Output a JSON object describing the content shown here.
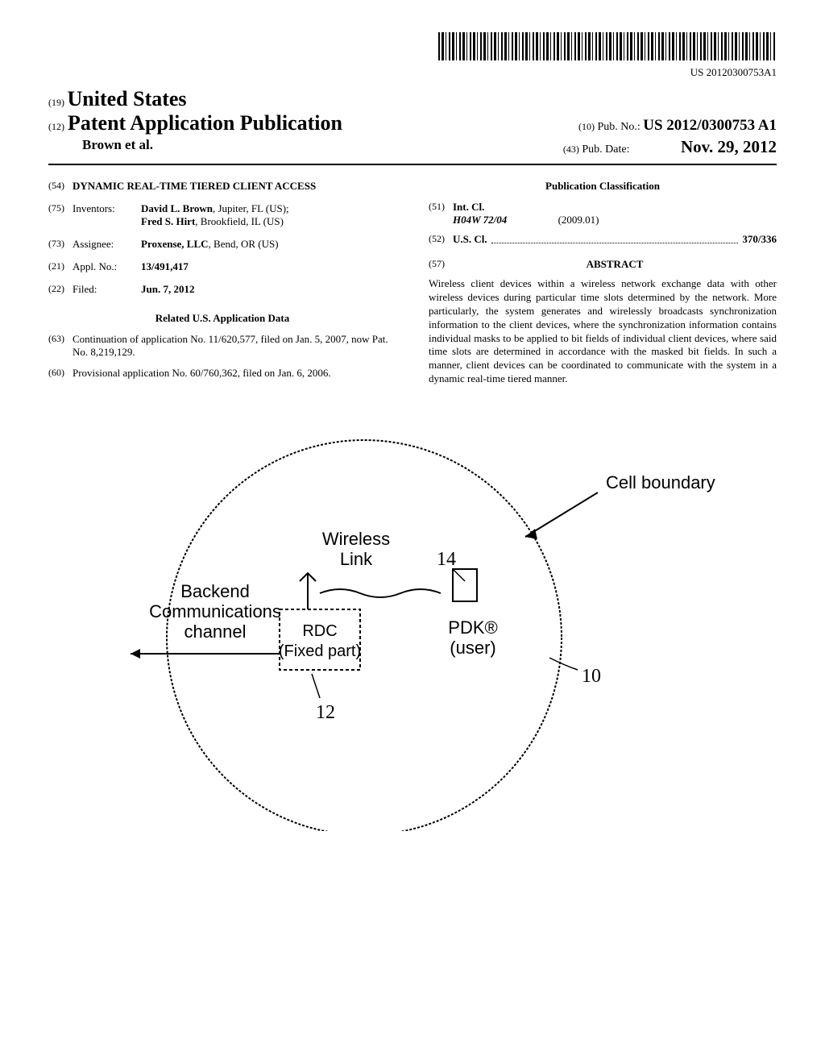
{
  "barcode_number": "US 20120300753A1",
  "header": {
    "country_num": "(19)",
    "country": "United States",
    "pub_type_num": "(12)",
    "pub_type": "Patent Application Publication",
    "pub_no_num": "(10)",
    "pub_no_label": "Pub. No.:",
    "pub_no_value": "US 2012/0300753 A1",
    "author": "Brown et al.",
    "pub_date_num": "(43)",
    "pub_date_label": "Pub. Date:",
    "pub_date_value": "Nov. 29, 2012"
  },
  "left": {
    "title_num": "(54)",
    "title": "DYNAMIC REAL-TIME TIERED CLIENT ACCESS",
    "inventors_num": "(75)",
    "inventors_label": "Inventors:",
    "inventor1_name": "David L. Brown",
    "inventor1_loc": ", Jupiter, FL (US);",
    "inventor2_name": "Fred S. Hirt",
    "inventor2_loc": ", Brookfield, IL (US)",
    "assignee_num": "(73)",
    "assignee_label": "Assignee:",
    "assignee_value": "Proxense, LLC",
    "assignee_loc": ", Bend, OR (US)",
    "appl_num": "(21)",
    "appl_label": "Appl. No.:",
    "appl_value": "13/491,417",
    "filed_num": "(22)",
    "filed_label": "Filed:",
    "filed_value": "Jun. 7, 2012",
    "related_header": "Related U.S. Application Data",
    "continuation_num": "(63)",
    "continuation_text": "Continuation of application No. 11/620,577, filed on Jan. 5, 2007, now Pat. No. 8,219,129.",
    "provisional_num": "(60)",
    "provisional_text": "Provisional application No. 60/760,362, filed on Jan. 6, 2006."
  },
  "right": {
    "classification_header": "Publication Classification",
    "int_cl_num": "(51)",
    "int_cl_label": "Int. Cl.",
    "int_cl_code": "H04W 72/04",
    "int_cl_year": "(2009.01)",
    "us_cl_num": "(52)",
    "us_cl_label": "U.S. Cl.",
    "us_cl_value": "370/336",
    "abstract_num": "(57)",
    "abstract_label": "ABSTRACT",
    "abstract_text": "Wireless client devices within a wireless network exchange data with other wireless devices during particular time slots determined by the network. More particularly, the system generates and wirelessly broadcasts synchronization information to the client devices, where the synchronization information contains individual masks to be applied to bit fields of individual client devices, where said time slots are determined in accordance with the masked bit fields. In such a manner, client devices can be coordinated to communicate with the system in a dynamic real-time tiered manner."
  },
  "figure": {
    "cell_boundary": "Cell boundary",
    "wireless_link": "Wireless",
    "link": "Link",
    "backend": "Backend",
    "communications": "Communications",
    "channel": "channel",
    "rdc": "RDC",
    "fixed_part": "(Fixed part)",
    "pdk": "PDK®",
    "user": "(user)",
    "ref_14": "14",
    "ref_12": "12",
    "ref_10": "10"
  }
}
